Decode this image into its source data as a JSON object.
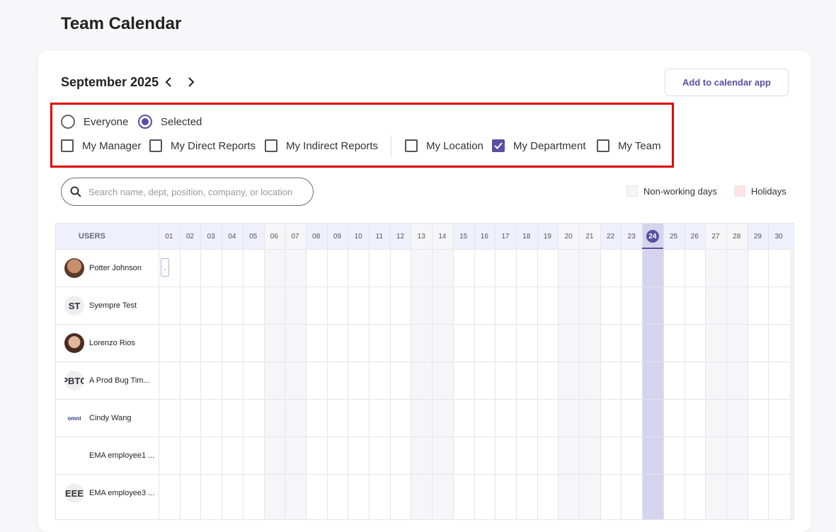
{
  "page": {
    "title": "Team Calendar"
  },
  "calendar": {
    "month": "September 2025",
    "add_button": "Add to calendar app",
    "filters": {
      "radios": [
        {
          "label": "Everyone",
          "selected": false
        },
        {
          "label": "Selected",
          "selected": true
        }
      ],
      "checks": [
        {
          "label": "My Manager",
          "checked": false
        },
        {
          "label": "My Direct Reports",
          "checked": false
        },
        {
          "label": "My Indirect Reports",
          "checked": false
        },
        {
          "label": "My Location",
          "checked": false
        },
        {
          "label": "My Department",
          "checked": true
        },
        {
          "label": "My Team",
          "checked": false
        }
      ]
    },
    "search": {
      "placeholder": "Search name, dept, position, company, or location",
      "value": ""
    },
    "legend": [
      {
        "label": "Non-working days",
        "color": "#f6f6f9"
      },
      {
        "label": "Holidays",
        "color": "#fde4e4"
      }
    ],
    "grid": {
      "users_header": "USERS",
      "days": [
        "01",
        "02",
        "03",
        "04",
        "05",
        "06",
        "07",
        "08",
        "09",
        "10",
        "11",
        "12",
        "13",
        "14",
        "15",
        "16",
        "17",
        "18",
        "19",
        "20",
        "21",
        "22",
        "23",
        "24",
        "25",
        "26",
        "27",
        "28",
        "29",
        "30"
      ],
      "today": "24",
      "non_working": [
        "06",
        "07",
        "13",
        "14",
        "20",
        "21",
        "27",
        "28"
      ],
      "users": [
        {
          "name": "Potter Johnson",
          "avatar": "photo",
          "initials": "",
          "event_day": "01",
          "event_label": ","
        },
        {
          "name": "Syempre Test",
          "avatar": "initials",
          "initials": "ST"
        },
        {
          "name": "Lorenzo Rios",
          "avatar": "photo",
          "initials": ""
        },
        {
          "name": "A Prod Bug Tim...",
          "avatar": "initials",
          "initials": "PBTC"
        },
        {
          "name": "Cindy Wang",
          "avatar": "logo",
          "initials": "omni"
        },
        {
          "name": "EMA employee1 ...",
          "avatar": "logo",
          "initials": ""
        },
        {
          "name": "EMA employee3 ...",
          "avatar": "initials",
          "initials": "EEE"
        }
      ]
    }
  },
  "colors": {
    "accent": "#5a4fa3",
    "highlight_border": "#e00000",
    "today_column": "#d6d3ee"
  }
}
